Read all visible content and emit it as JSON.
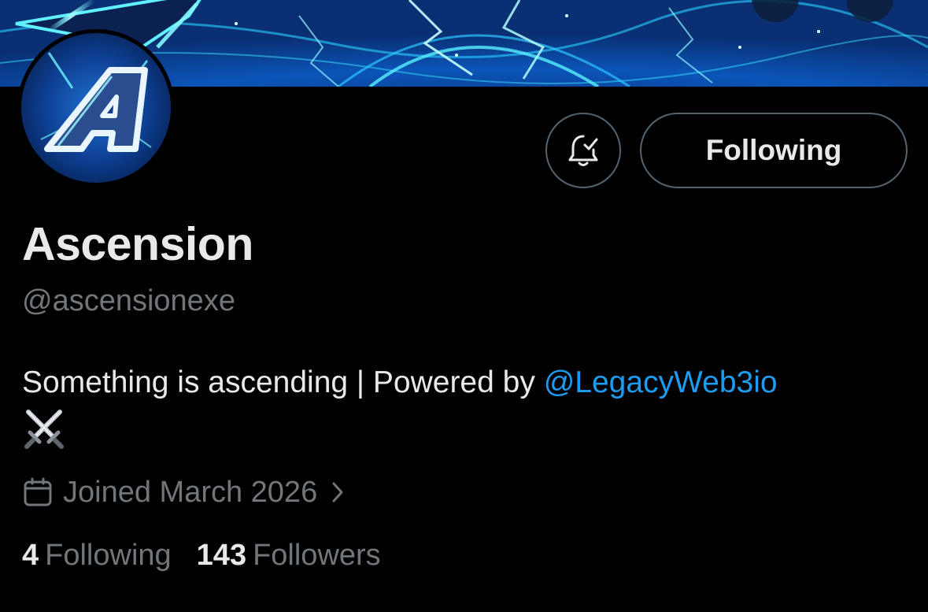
{
  "profile": {
    "display_name": "Ascension",
    "handle": "@ascensionexe",
    "bio_text": "Something is ascending | Powered by ",
    "bio_mention": "@LegacyWeb3io",
    "bio_emoji": "⚔️",
    "joined": "Joined March 2026"
  },
  "actions": {
    "follow_label": "Following",
    "notification_icon": "bell-check-icon"
  },
  "stats": {
    "following_count": "4",
    "following_label": "Following",
    "followers_count": "143",
    "followers_label": "Followers"
  },
  "colors": {
    "background": "#000000",
    "primary_text": "#e7e9ea",
    "secondary_text": "#71767b",
    "link": "#1d9bf0",
    "border": "#536471"
  }
}
